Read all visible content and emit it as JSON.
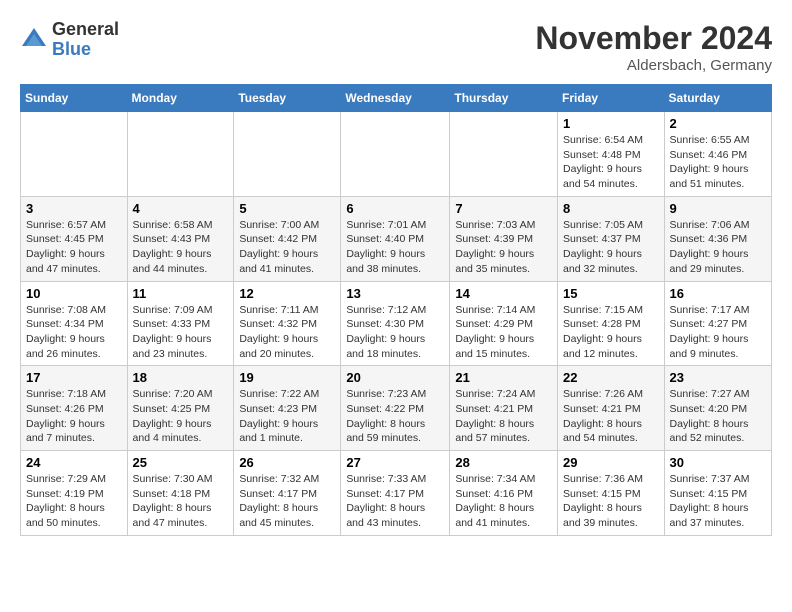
{
  "logo": {
    "general": "General",
    "blue": "Blue"
  },
  "title": "November 2024",
  "location": "Aldersbach, Germany",
  "days_of_week": [
    "Sunday",
    "Monday",
    "Tuesday",
    "Wednesday",
    "Thursday",
    "Friday",
    "Saturday"
  ],
  "weeks": [
    [
      {
        "day": "",
        "info": ""
      },
      {
        "day": "",
        "info": ""
      },
      {
        "day": "",
        "info": ""
      },
      {
        "day": "",
        "info": ""
      },
      {
        "day": "",
        "info": ""
      },
      {
        "day": "1",
        "info": "Sunrise: 6:54 AM\nSunset: 4:48 PM\nDaylight: 9 hours\nand 54 minutes."
      },
      {
        "day": "2",
        "info": "Sunrise: 6:55 AM\nSunset: 4:46 PM\nDaylight: 9 hours\nand 51 minutes."
      }
    ],
    [
      {
        "day": "3",
        "info": "Sunrise: 6:57 AM\nSunset: 4:45 PM\nDaylight: 9 hours\nand 47 minutes."
      },
      {
        "day": "4",
        "info": "Sunrise: 6:58 AM\nSunset: 4:43 PM\nDaylight: 9 hours\nand 44 minutes."
      },
      {
        "day": "5",
        "info": "Sunrise: 7:00 AM\nSunset: 4:42 PM\nDaylight: 9 hours\nand 41 minutes."
      },
      {
        "day": "6",
        "info": "Sunrise: 7:01 AM\nSunset: 4:40 PM\nDaylight: 9 hours\nand 38 minutes."
      },
      {
        "day": "7",
        "info": "Sunrise: 7:03 AM\nSunset: 4:39 PM\nDaylight: 9 hours\nand 35 minutes."
      },
      {
        "day": "8",
        "info": "Sunrise: 7:05 AM\nSunset: 4:37 PM\nDaylight: 9 hours\nand 32 minutes."
      },
      {
        "day": "9",
        "info": "Sunrise: 7:06 AM\nSunset: 4:36 PM\nDaylight: 9 hours\nand 29 minutes."
      }
    ],
    [
      {
        "day": "10",
        "info": "Sunrise: 7:08 AM\nSunset: 4:34 PM\nDaylight: 9 hours\nand 26 minutes."
      },
      {
        "day": "11",
        "info": "Sunrise: 7:09 AM\nSunset: 4:33 PM\nDaylight: 9 hours\nand 23 minutes."
      },
      {
        "day": "12",
        "info": "Sunrise: 7:11 AM\nSunset: 4:32 PM\nDaylight: 9 hours\nand 20 minutes."
      },
      {
        "day": "13",
        "info": "Sunrise: 7:12 AM\nSunset: 4:30 PM\nDaylight: 9 hours\nand 18 minutes."
      },
      {
        "day": "14",
        "info": "Sunrise: 7:14 AM\nSunset: 4:29 PM\nDaylight: 9 hours\nand 15 minutes."
      },
      {
        "day": "15",
        "info": "Sunrise: 7:15 AM\nSunset: 4:28 PM\nDaylight: 9 hours\nand 12 minutes."
      },
      {
        "day": "16",
        "info": "Sunrise: 7:17 AM\nSunset: 4:27 PM\nDaylight: 9 hours\nand 9 minutes."
      }
    ],
    [
      {
        "day": "17",
        "info": "Sunrise: 7:18 AM\nSunset: 4:26 PM\nDaylight: 9 hours\nand 7 minutes."
      },
      {
        "day": "18",
        "info": "Sunrise: 7:20 AM\nSunset: 4:25 PM\nDaylight: 9 hours\nand 4 minutes."
      },
      {
        "day": "19",
        "info": "Sunrise: 7:22 AM\nSunset: 4:23 PM\nDaylight: 9 hours\nand 1 minute."
      },
      {
        "day": "20",
        "info": "Sunrise: 7:23 AM\nSunset: 4:22 PM\nDaylight: 8 hours\nand 59 minutes."
      },
      {
        "day": "21",
        "info": "Sunrise: 7:24 AM\nSunset: 4:21 PM\nDaylight: 8 hours\nand 57 minutes."
      },
      {
        "day": "22",
        "info": "Sunrise: 7:26 AM\nSunset: 4:21 PM\nDaylight: 8 hours\nand 54 minutes."
      },
      {
        "day": "23",
        "info": "Sunrise: 7:27 AM\nSunset: 4:20 PM\nDaylight: 8 hours\nand 52 minutes."
      }
    ],
    [
      {
        "day": "24",
        "info": "Sunrise: 7:29 AM\nSunset: 4:19 PM\nDaylight: 8 hours\nand 50 minutes."
      },
      {
        "day": "25",
        "info": "Sunrise: 7:30 AM\nSunset: 4:18 PM\nDaylight: 8 hours\nand 47 minutes."
      },
      {
        "day": "26",
        "info": "Sunrise: 7:32 AM\nSunset: 4:17 PM\nDaylight: 8 hours\nand 45 minutes."
      },
      {
        "day": "27",
        "info": "Sunrise: 7:33 AM\nSunset: 4:17 PM\nDaylight: 8 hours\nand 43 minutes."
      },
      {
        "day": "28",
        "info": "Sunrise: 7:34 AM\nSunset: 4:16 PM\nDaylight: 8 hours\nand 41 minutes."
      },
      {
        "day": "29",
        "info": "Sunrise: 7:36 AM\nSunset: 4:15 PM\nDaylight: 8 hours\nand 39 minutes."
      },
      {
        "day": "30",
        "info": "Sunrise: 7:37 AM\nSunset: 4:15 PM\nDaylight: 8 hours\nand 37 minutes."
      }
    ]
  ]
}
